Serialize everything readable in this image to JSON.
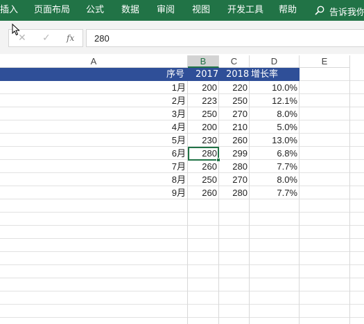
{
  "ribbon": {
    "menu": [
      "插入",
      "页面布局",
      "公式",
      "数据",
      "审阅",
      "视图",
      "开发工具",
      "帮助"
    ],
    "tell_me": "告诉我你"
  },
  "formula_bar": {
    "cancel_glyph": "✕",
    "enter_glyph": "✓",
    "fx_label": "fx",
    "value": "280"
  },
  "columns": [
    "A",
    "B",
    "C",
    "D",
    "E"
  ],
  "selected_column": "B",
  "table": {
    "header": [
      "序号",
      "2017",
      "2018",
      "增长率"
    ],
    "rows": [
      [
        "1月",
        "200",
        "220",
        "10.0%"
      ],
      [
        "2月",
        "223",
        "250",
        "12.1%"
      ],
      [
        "3月",
        "250",
        "270",
        "8.0%"
      ],
      [
        "4月",
        "200",
        "210",
        "5.0%"
      ],
      [
        "5月",
        "230",
        "260",
        "13.0%"
      ],
      [
        "6月",
        "280",
        "299",
        "6.8%"
      ],
      [
        "7月",
        "260",
        "280",
        "7.7%"
      ],
      [
        "8月",
        "250",
        "270",
        "8.0%"
      ],
      [
        "9月",
        "260",
        "280",
        "7.7%"
      ]
    ]
  },
  "colors": {
    "ribbon": "#217346",
    "header_band": "#2f4f98",
    "selection": "#217346"
  }
}
